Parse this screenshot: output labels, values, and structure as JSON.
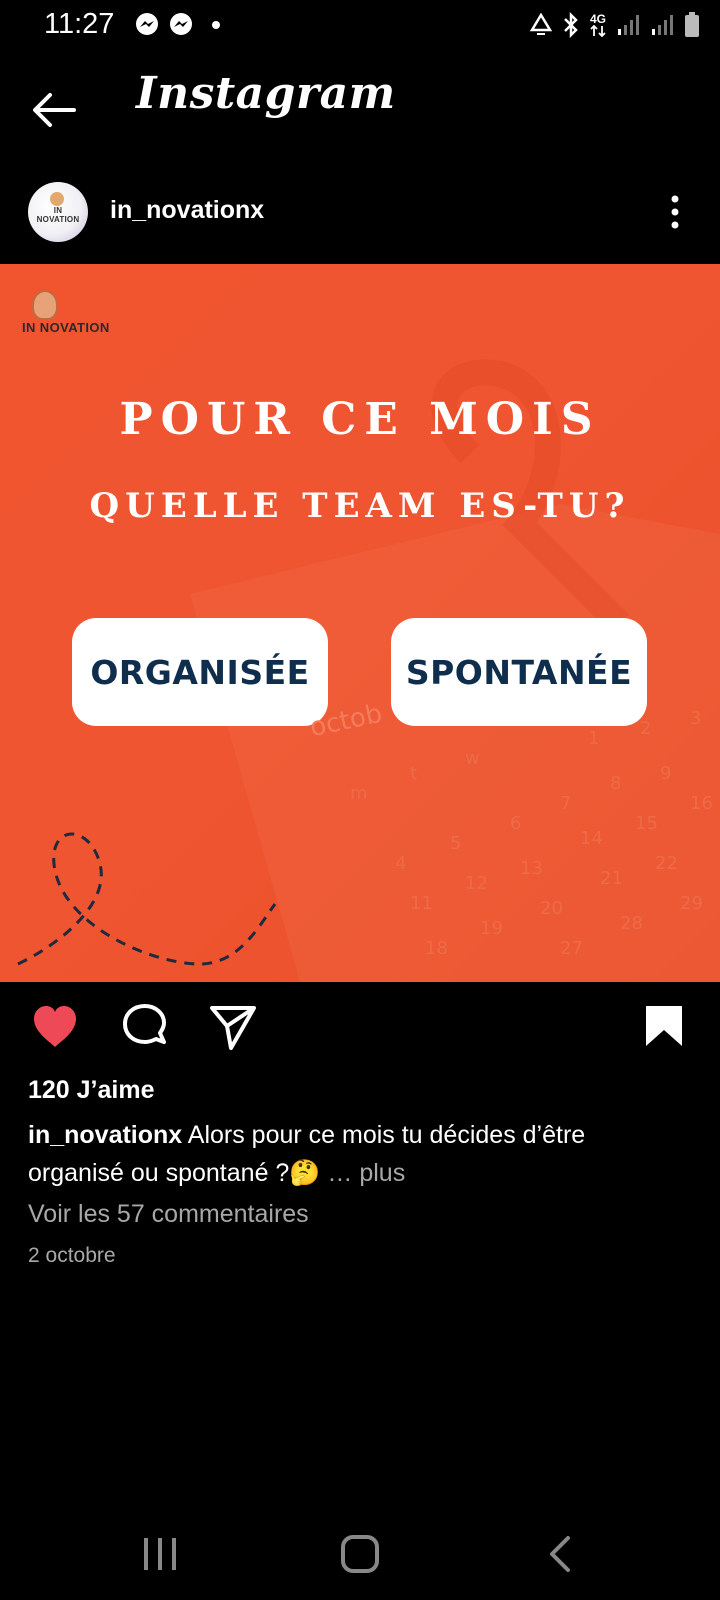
{
  "status_bar": {
    "time": "11:27",
    "network": "4G"
  },
  "header": {
    "title": "Instagram"
  },
  "post": {
    "username": "in_novationx",
    "avatar_text": "IN NOVATION",
    "image": {
      "brand": "IN NOVATION",
      "headline_1": "POUR CE MOIS",
      "headline_2": "QUELLE TEAM ES-TU?",
      "option_a": "ORGANISÉE",
      "option_b": "SPONTANÉE",
      "calendar_month": "octob"
    },
    "likes": "120 J’aime",
    "caption_user": "in_novationx",
    "caption_text": "Alors pour ce mois tu décides d’être organisé ou spontané ?🤔",
    "caption_more": "… plus",
    "comments_link": "Voir les 57 commentaires",
    "date": "2 octobre"
  },
  "icons": {
    "back": "arrow-left-icon",
    "more": "more-vertical-icon",
    "like": "heart-filled-icon",
    "comment": "comment-icon",
    "share": "send-icon",
    "save": "bookmark-filled-icon"
  },
  "colors": {
    "background": "#000000",
    "post_orange": "#ef552f",
    "like_red": "#ed4956",
    "button_text": "#0f2e4e",
    "muted_text": "#a8a8a8"
  }
}
